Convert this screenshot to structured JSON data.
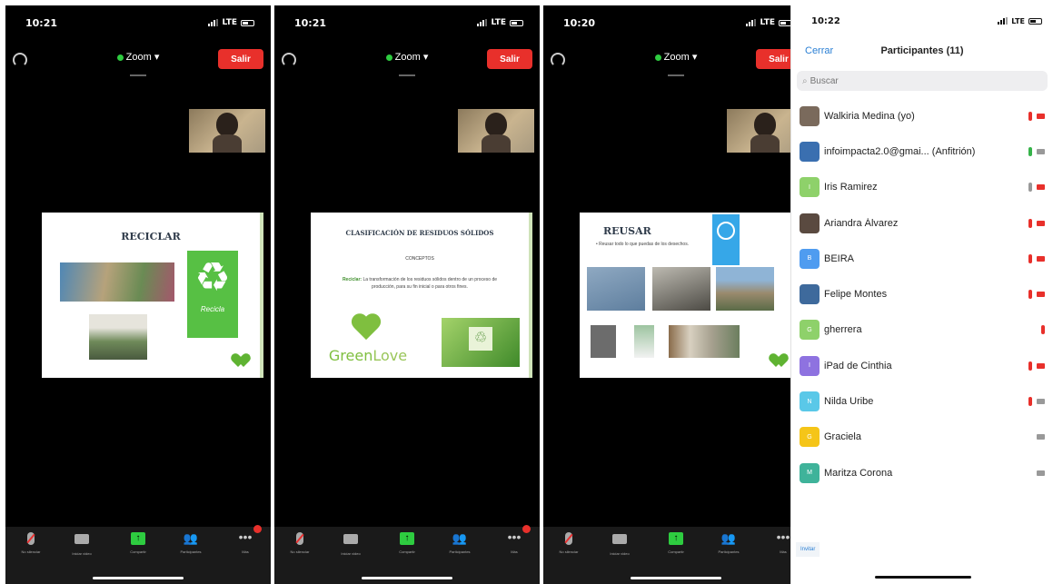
{
  "phones": [
    {
      "time": "10:21",
      "network": "LTE",
      "meeting_title": "Zoom",
      "leave_label": "Salir",
      "slide": {
        "title": "RECICLAR",
        "badge_label": "Recicla"
      }
    },
    {
      "time": "10:21",
      "network": "LTE",
      "meeting_title": "Zoom",
      "leave_label": "Salir",
      "slide": {
        "title": "CLASIFICACIÓN DE RESIDUOS SÓLIDOS",
        "subtitle": "CONCEPTOS",
        "body_term": "Reciclar:",
        "body_text": "La transformación de los residuos sólidos dentro de un proceso de producción, para su fin inicial o para otros fines.",
        "brand_a": "Green",
        "brand_b": "Love"
      }
    },
    {
      "time": "10:20",
      "network": "LTE",
      "meeting_title": "Zoom",
      "leave_label": "Salir",
      "slide": {
        "title": "REUSAR",
        "bullet": "• Reusar todo lo que puedas de los desechos."
      }
    }
  ],
  "toolbar": {
    "mute": "No silenciar",
    "video": "Iniciar video",
    "share": "Compartir",
    "participants": "Participantes",
    "more": "Más"
  },
  "participants_panel": {
    "time": "10:22",
    "network": "LTE",
    "close_label": "Cerrar",
    "title": "Participantes (11)",
    "search_placeholder": "Buscar",
    "invite_label": "Invitar",
    "list": [
      {
        "name": "Walkiria Medina (yo)",
        "avatar_color": "#7a6a5c",
        "initial": "",
        "mic": "muted",
        "video": "off"
      },
      {
        "name": "infoimpacta2.0@gmai... (Anfitrión)",
        "avatar_color": "#3a6fb0",
        "initial": "",
        "mic": "on",
        "video": "off-gray"
      },
      {
        "name": "Iris Ramirez",
        "avatar_color": "#8ed16a",
        "initial": "I",
        "mic": "gray",
        "video": "off"
      },
      {
        "name": "Ariandra Álvarez",
        "avatar_color": "#5a4a40",
        "initial": "",
        "mic": "muted",
        "video": "off"
      },
      {
        "name": "BEIRA",
        "avatar_color": "#4f9cf0",
        "initial": "B",
        "mic": "muted",
        "video": "off"
      },
      {
        "name": "Felipe Montes",
        "avatar_color": "#3e6a9c",
        "initial": "",
        "mic": "muted",
        "video": "off"
      },
      {
        "name": "gherrera",
        "avatar_color": "#8ed16a",
        "initial": "G",
        "mic": "muted",
        "video": "none"
      },
      {
        "name": "iPad de Cinthia",
        "avatar_color": "#8e72e0",
        "initial": "I",
        "mic": "muted",
        "video": "off"
      },
      {
        "name": "Nilda Uribe",
        "avatar_color": "#5ac8e8",
        "initial": "N",
        "mic": "muted",
        "video": "off-gray"
      },
      {
        "name": "Graciela",
        "avatar_color": "#f5c518",
        "initial": "G",
        "mic": "none",
        "video": "off-gray"
      },
      {
        "name": "Maritza Corona",
        "avatar_color": "#3fb39a",
        "initial": "M",
        "mic": "none",
        "video": "off-gray"
      }
    ]
  },
  "colors": {
    "leave": "#e8302b",
    "muted": "#e8302b",
    "active_mic": "#36b34a",
    "link": "#2a7fd4",
    "share": "#2ecc40"
  }
}
